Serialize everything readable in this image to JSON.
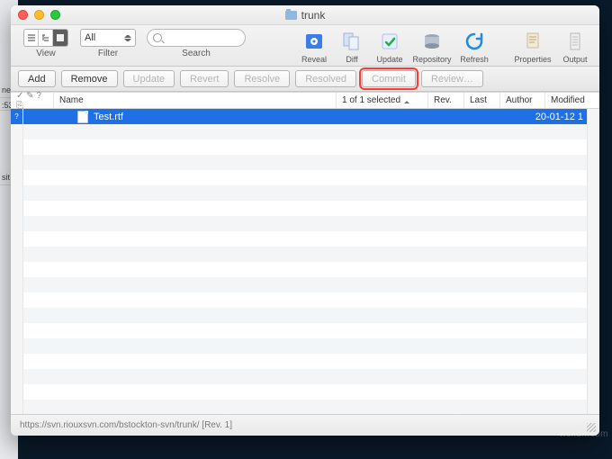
{
  "window": {
    "title": "trunk"
  },
  "toolbar": {
    "view_label": "View",
    "filter_label": "Filter",
    "filter_value": "All",
    "search_label": "Search",
    "items": {
      "reveal": "Reveal",
      "diff": "Diff",
      "update": "Update",
      "repository": "Repository",
      "refresh": "Refresh",
      "properties": "Properties",
      "output": "Output"
    }
  },
  "commands": {
    "add": "Add",
    "remove": "Remove",
    "update": "Update",
    "revert": "Revert",
    "resolve": "Resolve",
    "resolved": "Resolved",
    "commit": "Commit",
    "review": "Review…"
  },
  "headers": {
    "flags": "✓ ✎ ? ⎘",
    "name": "Name",
    "selection": "1 of 1 selected",
    "rev": "Rev.",
    "last": "Last",
    "author": "Author",
    "modified": "Modified"
  },
  "rows": [
    {
      "flag": "?",
      "name": "Test.rtf",
      "modified": "20-01-12 1"
    }
  ],
  "status": "https://svn.riouxsvn.com/bstockton-svn/trunk/   [Rev. 1]",
  "gutter_top": "✓ ✎ ? ⎘",
  "side_truncated": {
    "a": "ne",
    "b": ":53",
    "c": "sit"
  },
  "watermark": "wsxdn.com"
}
